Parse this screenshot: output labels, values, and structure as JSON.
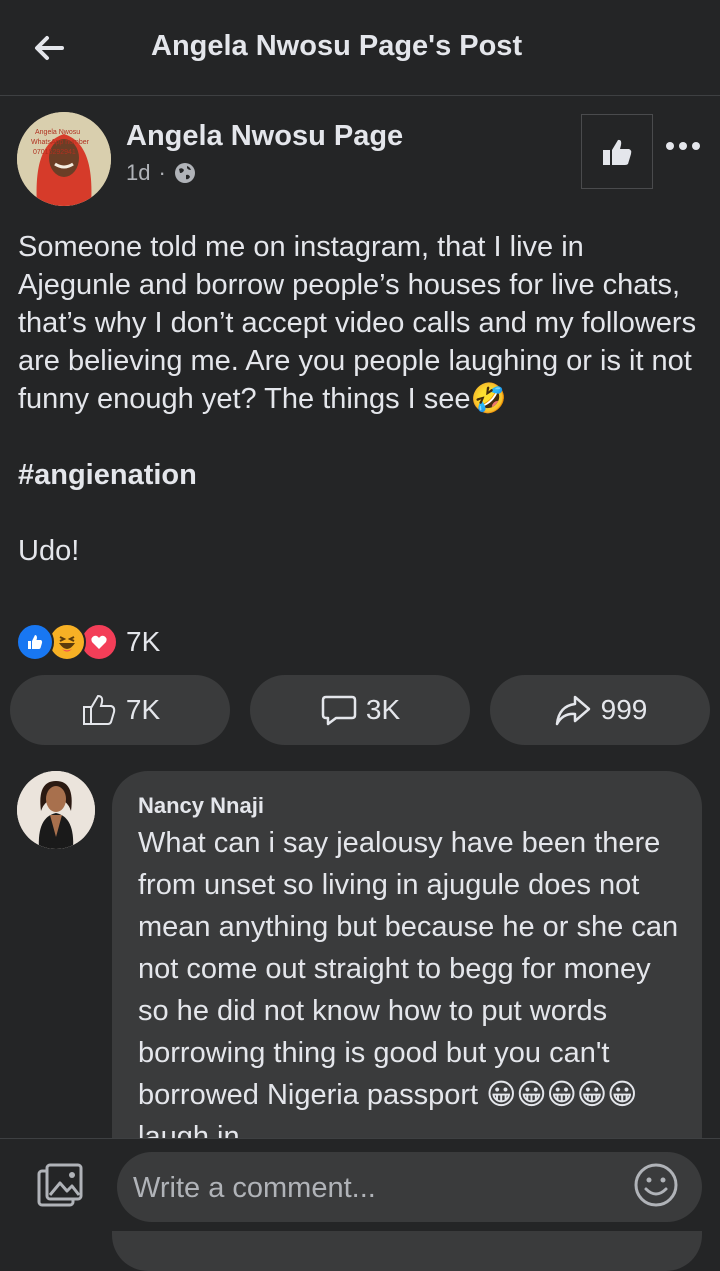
{
  "header": {
    "title": "Angela Nwosu Page's Post",
    "back_icon": "arrow-left-icon"
  },
  "post": {
    "author": "Angela Nwosu Page",
    "time": "1d",
    "separator": "·",
    "audience_icon": "globe-icon",
    "avatar_text_1": "Angela Nwosu",
    "avatar_text_2": "WhatsApp number",
    "avatar_text_3": "07015292941",
    "text": "Someone told me on instagram, that I live in Ajegunle and borrow people’s houses for live chats, that’s why I don’t accept video calls and my followers are believing me. Are you people laughing or is it not funny enough yet? The things I see🤣",
    "hashtag": "#angienation",
    "sign_off": "Udo!",
    "reaction_count": "7K",
    "reactions": [
      "like-reaction-icon",
      "haha-reaction-icon",
      "love-reaction-icon"
    ]
  },
  "actions": {
    "like_count": "7K",
    "comment_count": "3K",
    "share_count": "999"
  },
  "comment": {
    "author": "Nancy Nnaji",
    "text": "What can i say jealousy have been there from unset so living in ajugule does not mean anything but because he or she can not come out straight to begg for money so he did not know how to put words borrowing thing is good but you can't borrowed Nigeria passport 😀😀😀😀😀 laugh in"
  },
  "composer": {
    "placeholder": "Write a comment..."
  },
  "colors": {
    "background": "#242526",
    "surface": "#3a3b3c",
    "text": "#e4e6eb",
    "secondary_text": "#b0b3b8",
    "like_blue": "#1877f2",
    "love_red": "#f33e58",
    "haha_yellow": "#f7b125"
  }
}
